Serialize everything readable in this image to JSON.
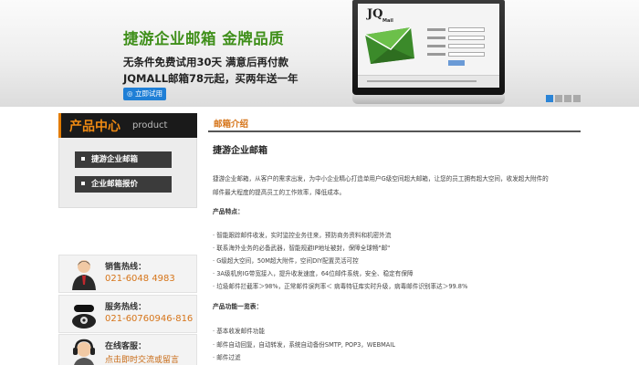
{
  "banner": {
    "title": "捷游企业邮箱   金牌品质",
    "line1": "无条件免费试用30天 满意后再付款",
    "line2": "JQMALL邮箱78元起，买两年送一年",
    "button": "◎ 立即试用",
    "screen_logo": "JQ",
    "screen_logo_sub": "Mail",
    "slide_count": 4
  },
  "left": {
    "product_title": "产品中心",
    "product_title_en": "product",
    "menu": [
      "捷游企业邮箱",
      "企业邮箱报价"
    ],
    "contacts": [
      {
        "label": "销售热线：",
        "value": "021-6048 4983",
        "icon": "person-icon"
      },
      {
        "label": "服务热线：",
        "value": "021-60760946-816",
        "icon": "phone-icon"
      },
      {
        "label": "在线客服：",
        "value": "点击即时交流或留言",
        "icon": "headset-icon"
      }
    ]
  },
  "right": {
    "section_title": "邮箱介绍",
    "heading": "捷游企业邮箱",
    "intro_line1": "捷游企业邮箱，从客户的需求出发，为中小企业精心打造单用户G级空间超大邮箱，让您的员工拥有超大空间，收发超大附件的",
    "intro_line2": "邮件最大程度的提高员工的工作效率，降低成本。",
    "features_title": "产品特点：",
    "features": [
      "· 智能跟踪邮件收发，实时监控业务往来，预防商务资料和机密外流",
      "· 联系海外业务的必备武器，智能规避IP地址被封，保障全球畅\"邮\"",
      "· G级超大空间，50M超大附件，空间DIY配置灵活可控",
      "· 3A级机房IG带宽接入，提升收发速度，64位邮件系统，安全、稳定有保障",
      "· 垃圾邮件拦截率＞98%，正常邮件误判率＜  病毒特征库实时升级，病毒邮件识别率达＞99.8%"
    ],
    "functions_title": "产品功能一览表：",
    "functions": [
      "· 基本收发邮件功能",
      "· 邮件自动回复，自动转发，系统自动备份SMTP, POP3，WEBMAIL",
      "· 邮件过滤"
    ]
  },
  "colors": {
    "accent_orange": "#d6751a",
    "banner_green": "#3f8f1a",
    "button_blue": "#1f7fd6"
  }
}
